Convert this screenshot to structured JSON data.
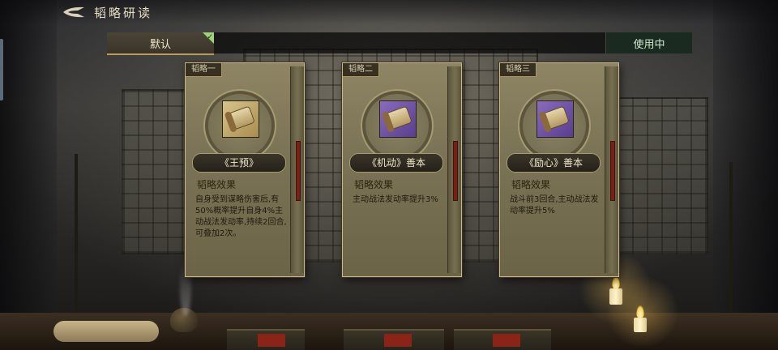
{
  "header": {
    "title": "韬略研读",
    "back_icon": "back-arrow-icon"
  },
  "tabs": {
    "default_label": "默认",
    "default_selected": true,
    "in_use_label": "使用中"
  },
  "cards": [
    {
      "slot_label": "韬略一",
      "name": "《王预》",
      "effect_label": "韬略效果",
      "description": "自身受到谋略伤害后,有50%概率提升自身4%主动战法发动率,持续2回合,可叠加2次。",
      "icon": "bamboo-scroll-icon",
      "rarity_color": "#d7c48b"
    },
    {
      "slot_label": "韬略二",
      "name": "《机动》善本",
      "effect_label": "韬略效果",
      "description": "主动战法发动率提升3%",
      "icon": "scroll-icon",
      "rarity_color": "#8a6bbd"
    },
    {
      "slot_label": "韬略三",
      "name": "《励心》善本",
      "effect_label": "韬略效果",
      "description": "战斗前3回合,主动战法发动率提升5%",
      "icon": "scroll-icon",
      "rarity_color": "#8a6bbd"
    }
  ]
}
